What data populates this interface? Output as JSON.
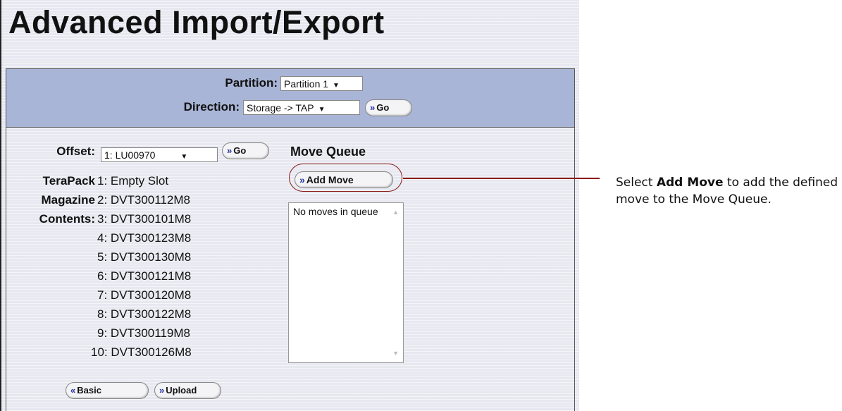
{
  "page": {
    "title": "Advanced Import/Export"
  },
  "filters": {
    "partition_label": "Partition:",
    "partition_value": "Partition 1",
    "direction_label": "Direction:",
    "direction_value": "Storage -> TAP",
    "go_label": "Go"
  },
  "offset": {
    "label": "Offset:",
    "value": "1: LU00970",
    "go_label": "Go"
  },
  "contents": {
    "label_lines": [
      "TeraPack",
      "Magazine",
      "Contents:"
    ],
    "items": [
      "1: Empty Slot",
      "2: DVT300112M8",
      "3: DVT300101M8",
      "4: DVT300123M8",
      "5: DVT300130M8",
      "6: DVT300121M8",
      "7: DVT300120M8",
      "8: DVT300122M8",
      "9: DVT300119M8",
      "10: DVT300126M8"
    ]
  },
  "queue": {
    "heading": "Move Queue",
    "add_move_label": "Add Move",
    "empty_text": "No moves in queue"
  },
  "footer": {
    "basic_label": "Basic",
    "upload_label": "Upload"
  },
  "callout": {
    "prefix": "Select ",
    "bold": "Add Move",
    "suffix": " to add the defined move to the Move Queue."
  },
  "colors": {
    "panel_header": "#a9b5d6",
    "background": "#e7e8f0",
    "callout_accent": "#8a1c1c",
    "chevron": "#2433a4"
  },
  "icons": {
    "forward": "double-chevron-right-icon",
    "back": "double-chevron-left-icon",
    "dropdown": "caret-down-icon"
  }
}
